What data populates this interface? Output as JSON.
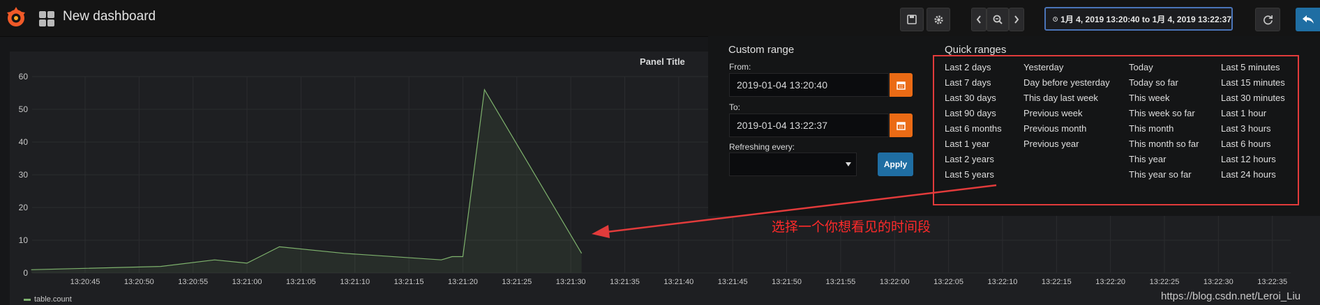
{
  "header": {
    "dashboard_title": "New dashboard",
    "time_range_label": "1月 4, 2019 13:20:40 to 1月 4, 2019 13:22:37"
  },
  "panel": {
    "title": "Panel Title",
    "legend": "table.count"
  },
  "time_picker": {
    "custom_range_title": "Custom range",
    "from_label": "From:",
    "from_value": "2019-01-04 13:20:40",
    "to_label": "To:",
    "to_value": "2019-01-04 13:22:37",
    "refresh_label": "Refreshing every:",
    "refresh_value": "",
    "apply_label": "Apply",
    "quick_ranges_title": "Quick ranges",
    "quick_ranges": [
      [
        "Last 2 days",
        "Last 7 days",
        "Last 30 days",
        "Last 90 days",
        "Last 6 months",
        "Last 1 year",
        "Last 2 years",
        "Last 5 years"
      ],
      [
        "Yesterday",
        "Day before yesterday",
        "This day last week",
        "Previous week",
        "Previous month",
        "Previous year"
      ],
      [
        "Today",
        "Today so far",
        "This week",
        "This week so far",
        "This month",
        "This month so far",
        "This year",
        "This year so far"
      ],
      [
        "Last 5 minutes",
        "Last 15 minutes",
        "Last 30 minutes",
        "Last 1 hour",
        "Last 3 hours",
        "Last 6 hours",
        "Last 12 hours",
        "Last 24 hours"
      ]
    ]
  },
  "annotation_text": "选择一个你想看见的时间段",
  "watermark": "https://blog.csdn.net/Leroi_Liu",
  "colors": {
    "series": "#7eb26d",
    "accent": "#1f6ea3",
    "calendar_button": "#eb6b15",
    "highlight": "#e23b3b"
  },
  "chart_data": {
    "type": "area",
    "title": "Panel Title",
    "ylim": [
      0,
      60
    ],
    "y_ticks": [
      "0",
      "10",
      "20",
      "30",
      "40",
      "50",
      "60"
    ],
    "x_ticks": [
      "13:20:45",
      "13:20:50",
      "13:20:55",
      "13:21:00",
      "13:21:05",
      "13:21:10",
      "13:21:15",
      "13:21:20",
      "13:21:25",
      "13:21:30",
      "13:21:35",
      "13:21:40",
      "13:21:45",
      "13:21:50",
      "13:21:55",
      "13:22:00",
      "13:22:05",
      "13:22:10",
      "13:22:15",
      "13:22:20",
      "13:22:25",
      "13:22:30",
      "13:22:35"
    ],
    "series": [
      {
        "name": "table.count",
        "color": "#7eb26d",
        "points": [
          [
            "13:20:40",
            1
          ],
          [
            "13:20:52",
            2
          ],
          [
            "13:20:57",
            4
          ],
          [
            "13:21:00",
            3
          ],
          [
            "13:21:03",
            8
          ],
          [
            "13:21:09",
            6
          ],
          [
            "13:21:18",
            4
          ],
          [
            "13:21:19",
            5
          ],
          [
            "13:21:20",
            5
          ],
          [
            "13:21:22",
            56
          ],
          [
            "13:21:31",
            6
          ]
        ]
      }
    ],
    "legend": "bottom-left",
    "grid": true
  }
}
